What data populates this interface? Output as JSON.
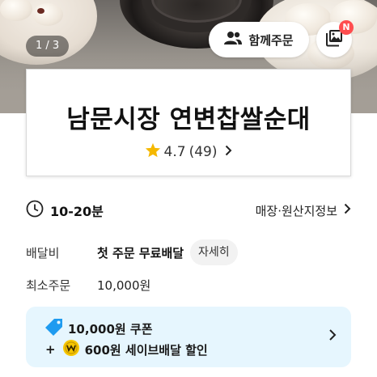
{
  "hero": {
    "pager": "1 / 3",
    "together_order_label": "함께주문",
    "photo_badge": "N"
  },
  "store": {
    "name": "남문시장 연변찹쌀순대",
    "rating": "4.7",
    "review_count": "(49)"
  },
  "delivery": {
    "time": "10-20분",
    "store_info_label": "매장·원산지정보",
    "fee_label": "배달비",
    "fee_value": "첫 주문 무료배달",
    "fee_detail_button": "자세히",
    "min_order_label": "최소주문",
    "min_order_value": "10,000원"
  },
  "coupon": {
    "line1": "10,000원 쿠폰",
    "plus": "+",
    "line2": "600원 세이브배달 할인"
  },
  "colors": {
    "star": "#f5b800",
    "coupon_bg": "#e6f6fe",
    "coupon_tag": "#1e9bf0",
    "badge": "#ff4d4f",
    "save_coin": "#f7c600"
  }
}
